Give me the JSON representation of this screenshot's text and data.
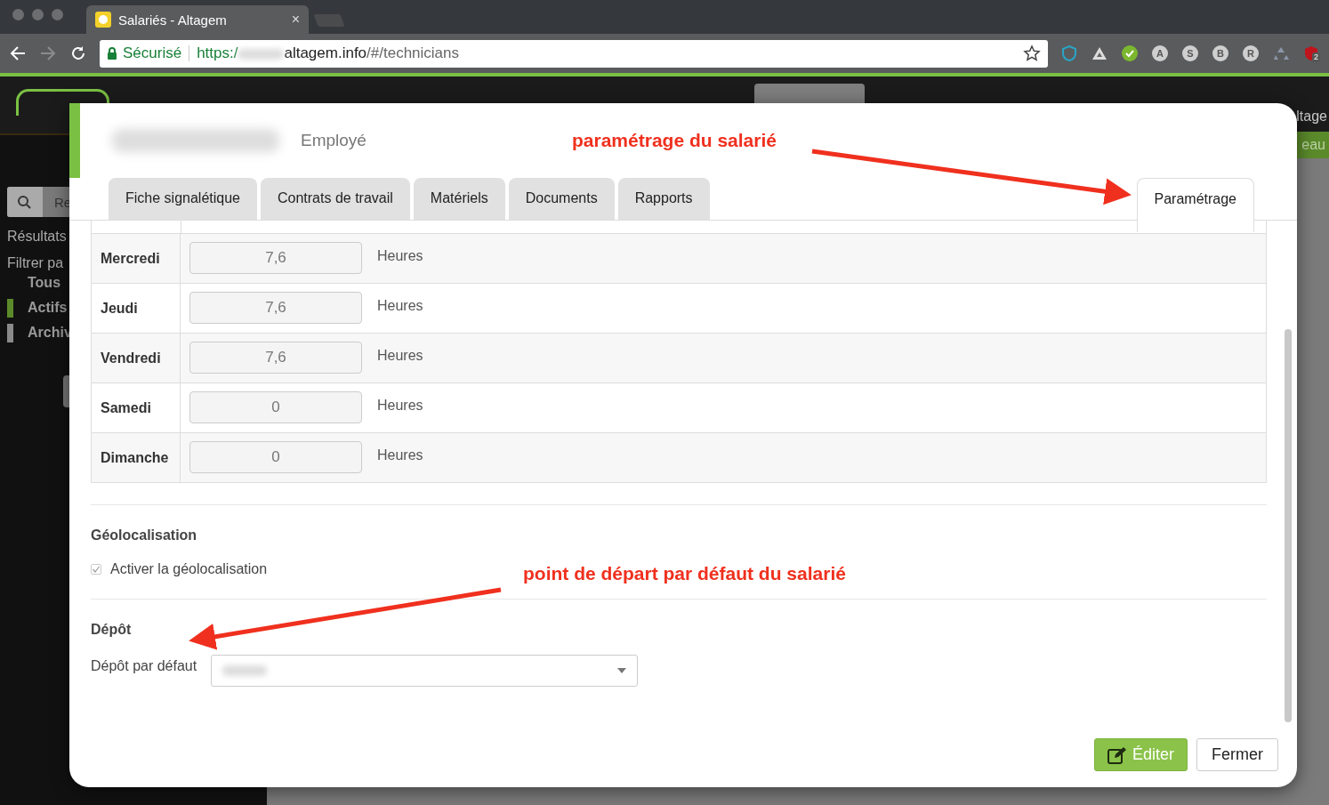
{
  "browser": {
    "tab_title": "Salariés - Altagem",
    "tab_close": "×",
    "security_label": "Sécurisé",
    "url_scheme": "https:/",
    "url_host": "altagem.info",
    "url_path": "/#/technicians",
    "extensions": [
      {
        "kind": "shield"
      },
      {
        "kind": "triangle"
      },
      {
        "kind": "check"
      },
      {
        "kind": "letter",
        "letter": "A"
      },
      {
        "kind": "letter",
        "letter": "S"
      },
      {
        "kind": "letter",
        "letter": "B"
      },
      {
        "kind": "letter",
        "letter": "R"
      },
      {
        "kind": "recycle"
      },
      {
        "kind": "badge",
        "letter": "2"
      }
    ]
  },
  "background": {
    "search_placeholder": "Re",
    "sidebar_texts": [
      "Résultats",
      "Filtrer pa"
    ],
    "filters": [
      {
        "label": "Tous"
      },
      {
        "label": "Actifs",
        "color": "#5b8a2b"
      },
      {
        "label": "Archiv",
        "color": "#8a8a8a"
      }
    ],
    "right_texts": [
      "ltage",
      "eau"
    ]
  },
  "modal": {
    "role": "Employé",
    "tabs": [
      {
        "label": "Fiche signalétique",
        "selected": false
      },
      {
        "label": "Contrats de travail",
        "selected": false
      },
      {
        "label": "Matériels",
        "selected": false
      },
      {
        "label": "Documents",
        "selected": false
      },
      {
        "label": "Rapports",
        "selected": false
      },
      {
        "label": "Paramétrage",
        "selected": true
      }
    ],
    "schedule": [
      {
        "day": "Mercredi",
        "value": "7,6",
        "unit": "Heures"
      },
      {
        "day": "Jeudi",
        "value": "7,6",
        "unit": "Heures"
      },
      {
        "day": "Vendredi",
        "value": "7,6",
        "unit": "Heures"
      },
      {
        "day": "Samedi",
        "value": "0",
        "unit": "Heures"
      },
      {
        "day": "Dimanche",
        "value": "0",
        "unit": "Heures"
      }
    ],
    "geolocation": {
      "heading": "Géolocalisation",
      "checkbox": {
        "label": "Activer la géolocalisation",
        "checked": true
      }
    },
    "depot": {
      "heading": "Dépôt",
      "field_label": "Dépôt par défaut"
    },
    "buttons": [
      {
        "label": "Éditer",
        "kind": "primary"
      },
      {
        "label": "Fermer",
        "kind": "default"
      }
    ]
  },
  "annotations": [
    "paramétrage du salarié",
    "point de départ par défaut du salarié"
  ]
}
